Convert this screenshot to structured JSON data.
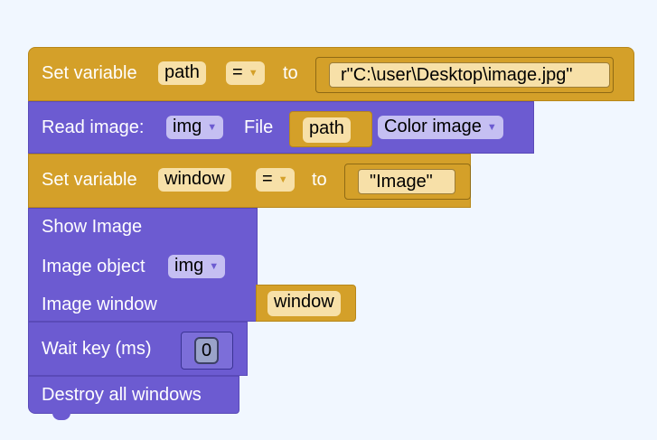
{
  "blocks": {
    "set_path": {
      "label": "Set variable",
      "variable": "path",
      "operator": "=",
      "to_label": "to",
      "value": "r\"C:\\user\\Desktop\\image.jpg\""
    },
    "read_image": {
      "label": "Read image:",
      "variable": "img",
      "file_label": "File",
      "file_value": "path",
      "mode": "Color image"
    },
    "set_window": {
      "label": "Set variable",
      "variable": "window",
      "operator": "=",
      "to_label": "to",
      "value": "\"Image\""
    },
    "show_image": {
      "title": "Show Image",
      "object_label": "Image object",
      "object_value": "img",
      "window_label": "Image window",
      "window_value": "window"
    },
    "wait_key": {
      "label": "Wait key (ms)",
      "value": "0"
    },
    "destroy": {
      "label": "Destroy all windows"
    }
  },
  "icons": {
    "dropdown": "dropdown-arrow-icon"
  },
  "colors": {
    "variable_block": "#d4a029",
    "cv_block": "#6c5bd1",
    "background": "#f1f7ff"
  }
}
